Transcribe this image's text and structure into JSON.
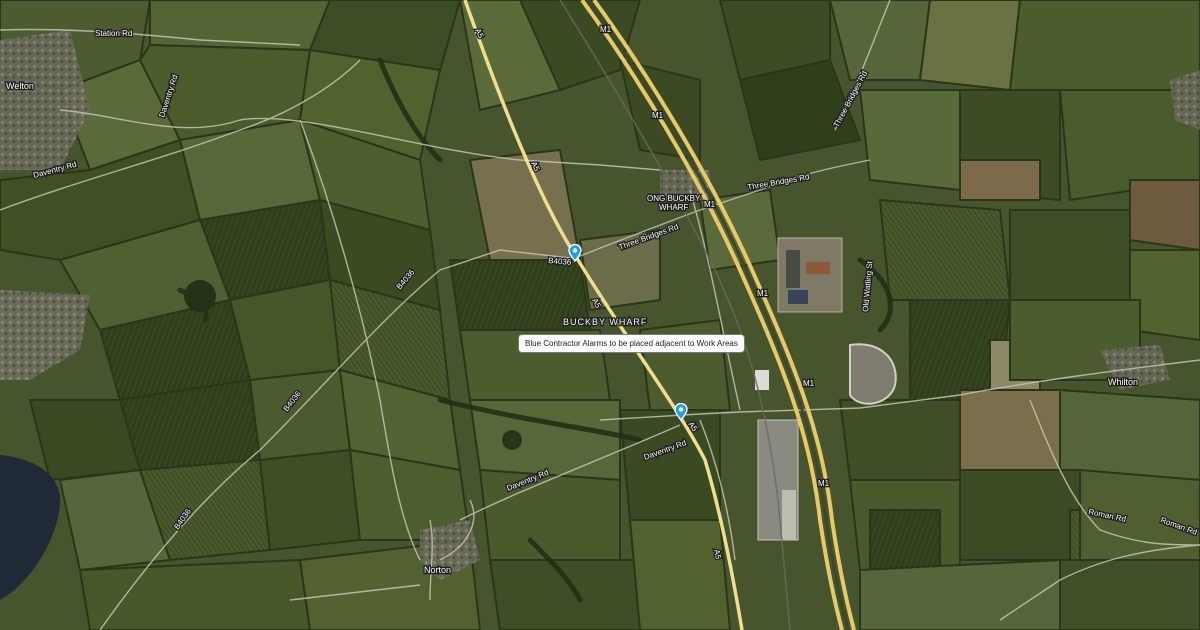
{
  "map": {
    "type": "satellite",
    "accent_colors": {
      "motorway": "#e7c96a",
      "pin": "#1e9fe6",
      "water": "#1f2a36"
    }
  },
  "labels": {
    "places": {
      "buckby_wharf": "BUCKBY WHARF",
      "long_buckby_wharf_1": "ONG BUCKBY",
      "long_buckby_wharf_2": "WHARF"
    },
    "towns": {
      "welton": "Welton",
      "whilton": "Whilton",
      "norton": "Norton"
    },
    "roads": {
      "station_rd": "Station Rd",
      "daventry_rd_1": "Daventry Rd",
      "daventry_rd_2": "Daventry Rd",
      "daventry_rd_3": "Daventry Rd",
      "daventry_rd_4": "Daventry Rd",
      "three_bridges_rd_1": "Three Bridges Rd",
      "three_bridges_rd_2": "Three Bridges Rd",
      "three_bridges_rd_3": "Three Bridges Rd",
      "b4036_1": "B4036",
      "b4036_2": "B4036",
      "b4036_3": "B4036",
      "b4036_4": "B4036",
      "a5_1": "A5",
      "a5_2": "A5",
      "a5_3": "A5",
      "a5_4": "A5",
      "a5_5": "A5",
      "m1_1": "M1",
      "m1_2": "M1",
      "m1_3": "M1",
      "m1_4": "M1",
      "m1_5": "M1",
      "m1_6": "M1",
      "old_watling": "Old Watling St",
      "roman_rd_1": "Roman Rd",
      "roman_rd_2": "Roman Rd"
    }
  },
  "annotation": {
    "text": "Blue Contractor Alarms to be placed adjacent to Work Areas"
  },
  "markers": [
    {
      "name": "alarm-pin-north",
      "icon": "map-pin-icon"
    },
    {
      "name": "alarm-pin-south",
      "icon": "map-pin-icon"
    }
  ]
}
